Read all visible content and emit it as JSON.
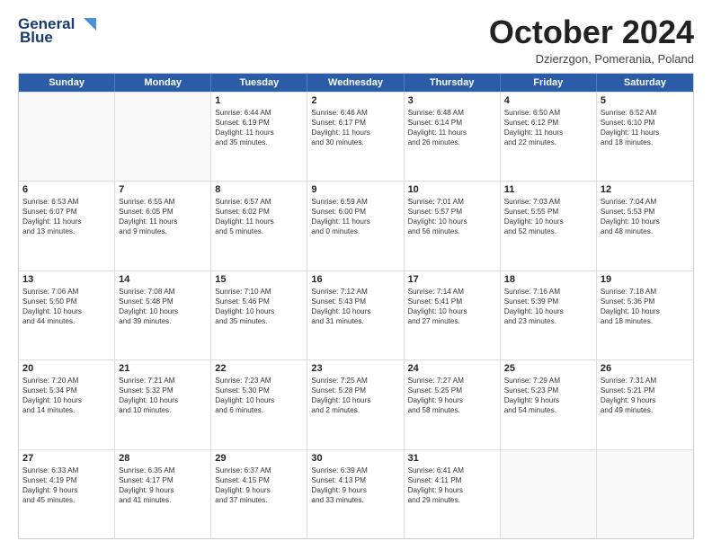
{
  "header": {
    "logo_line1": "General",
    "logo_line2": "Blue",
    "month": "October 2024",
    "location": "Dzierzgon, Pomerania, Poland"
  },
  "weekdays": [
    "Sunday",
    "Monday",
    "Tuesday",
    "Wednesday",
    "Thursday",
    "Friday",
    "Saturday"
  ],
  "weeks": [
    [
      {
        "day": "",
        "lines": []
      },
      {
        "day": "",
        "lines": []
      },
      {
        "day": "1",
        "lines": [
          "Sunrise: 6:44 AM",
          "Sunset: 6:19 PM",
          "Daylight: 11 hours",
          "and 35 minutes."
        ]
      },
      {
        "day": "2",
        "lines": [
          "Sunrise: 6:46 AM",
          "Sunset: 6:17 PM",
          "Daylight: 11 hours",
          "and 30 minutes."
        ]
      },
      {
        "day": "3",
        "lines": [
          "Sunrise: 6:48 AM",
          "Sunset: 6:14 PM",
          "Daylight: 11 hours",
          "and 26 minutes."
        ]
      },
      {
        "day": "4",
        "lines": [
          "Sunrise: 6:50 AM",
          "Sunset: 6:12 PM",
          "Daylight: 11 hours",
          "and 22 minutes."
        ]
      },
      {
        "day": "5",
        "lines": [
          "Sunrise: 6:52 AM",
          "Sunset: 6:10 PM",
          "Daylight: 11 hours",
          "and 18 minutes."
        ]
      }
    ],
    [
      {
        "day": "6",
        "lines": [
          "Sunrise: 6:53 AM",
          "Sunset: 6:07 PM",
          "Daylight: 11 hours",
          "and 13 minutes."
        ]
      },
      {
        "day": "7",
        "lines": [
          "Sunrise: 6:55 AM",
          "Sunset: 6:05 PM",
          "Daylight: 11 hours",
          "and 9 minutes."
        ]
      },
      {
        "day": "8",
        "lines": [
          "Sunrise: 6:57 AM",
          "Sunset: 6:02 PM",
          "Daylight: 11 hours",
          "and 5 minutes."
        ]
      },
      {
        "day": "9",
        "lines": [
          "Sunrise: 6:59 AM",
          "Sunset: 6:00 PM",
          "Daylight: 11 hours",
          "and 0 minutes."
        ]
      },
      {
        "day": "10",
        "lines": [
          "Sunrise: 7:01 AM",
          "Sunset: 5:57 PM",
          "Daylight: 10 hours",
          "and 56 minutes."
        ]
      },
      {
        "day": "11",
        "lines": [
          "Sunrise: 7:03 AM",
          "Sunset: 5:55 PM",
          "Daylight: 10 hours",
          "and 52 minutes."
        ]
      },
      {
        "day": "12",
        "lines": [
          "Sunrise: 7:04 AM",
          "Sunset: 5:53 PM",
          "Daylight: 10 hours",
          "and 48 minutes."
        ]
      }
    ],
    [
      {
        "day": "13",
        "lines": [
          "Sunrise: 7:06 AM",
          "Sunset: 5:50 PM",
          "Daylight: 10 hours",
          "and 44 minutes."
        ]
      },
      {
        "day": "14",
        "lines": [
          "Sunrise: 7:08 AM",
          "Sunset: 5:48 PM",
          "Daylight: 10 hours",
          "and 39 minutes."
        ]
      },
      {
        "day": "15",
        "lines": [
          "Sunrise: 7:10 AM",
          "Sunset: 5:46 PM",
          "Daylight: 10 hours",
          "and 35 minutes."
        ]
      },
      {
        "day": "16",
        "lines": [
          "Sunrise: 7:12 AM",
          "Sunset: 5:43 PM",
          "Daylight: 10 hours",
          "and 31 minutes."
        ]
      },
      {
        "day": "17",
        "lines": [
          "Sunrise: 7:14 AM",
          "Sunset: 5:41 PM",
          "Daylight: 10 hours",
          "and 27 minutes."
        ]
      },
      {
        "day": "18",
        "lines": [
          "Sunrise: 7:16 AM",
          "Sunset: 5:39 PM",
          "Daylight: 10 hours",
          "and 23 minutes."
        ]
      },
      {
        "day": "19",
        "lines": [
          "Sunrise: 7:18 AM",
          "Sunset: 5:36 PM",
          "Daylight: 10 hours",
          "and 18 minutes."
        ]
      }
    ],
    [
      {
        "day": "20",
        "lines": [
          "Sunrise: 7:20 AM",
          "Sunset: 5:34 PM",
          "Daylight: 10 hours",
          "and 14 minutes."
        ]
      },
      {
        "day": "21",
        "lines": [
          "Sunrise: 7:21 AM",
          "Sunset: 5:32 PM",
          "Daylight: 10 hours",
          "and 10 minutes."
        ]
      },
      {
        "day": "22",
        "lines": [
          "Sunrise: 7:23 AM",
          "Sunset: 5:30 PM",
          "Daylight: 10 hours",
          "and 6 minutes."
        ]
      },
      {
        "day": "23",
        "lines": [
          "Sunrise: 7:25 AM",
          "Sunset: 5:28 PM",
          "Daylight: 10 hours",
          "and 2 minutes."
        ]
      },
      {
        "day": "24",
        "lines": [
          "Sunrise: 7:27 AM",
          "Sunset: 5:25 PM",
          "Daylight: 9 hours",
          "and 58 minutes."
        ]
      },
      {
        "day": "25",
        "lines": [
          "Sunrise: 7:29 AM",
          "Sunset: 5:23 PM",
          "Daylight: 9 hours",
          "and 54 minutes."
        ]
      },
      {
        "day": "26",
        "lines": [
          "Sunrise: 7:31 AM",
          "Sunset: 5:21 PM",
          "Daylight: 9 hours",
          "and 49 minutes."
        ]
      }
    ],
    [
      {
        "day": "27",
        "lines": [
          "Sunrise: 6:33 AM",
          "Sunset: 4:19 PM",
          "Daylight: 9 hours",
          "and 45 minutes."
        ]
      },
      {
        "day": "28",
        "lines": [
          "Sunrise: 6:35 AM",
          "Sunset: 4:17 PM",
          "Daylight: 9 hours",
          "and 41 minutes."
        ]
      },
      {
        "day": "29",
        "lines": [
          "Sunrise: 6:37 AM",
          "Sunset: 4:15 PM",
          "Daylight: 9 hours",
          "and 37 minutes."
        ]
      },
      {
        "day": "30",
        "lines": [
          "Sunrise: 6:39 AM",
          "Sunset: 4:13 PM",
          "Daylight: 9 hours",
          "and 33 minutes."
        ]
      },
      {
        "day": "31",
        "lines": [
          "Sunrise: 6:41 AM",
          "Sunset: 4:11 PM",
          "Daylight: 9 hours",
          "and 29 minutes."
        ]
      },
      {
        "day": "",
        "lines": []
      },
      {
        "day": "",
        "lines": []
      }
    ]
  ]
}
